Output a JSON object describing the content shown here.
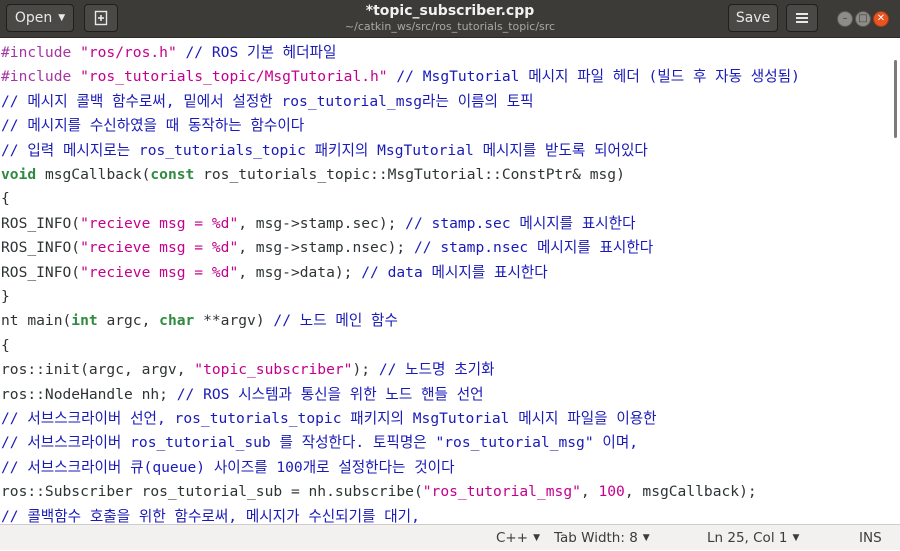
{
  "header": {
    "open_label": "Open",
    "save_label": "Save",
    "title": "*topic_subscriber.cpp",
    "subtitle": "~/catkin_ws/src/ros_tutorials_topic/src"
  },
  "editor": {
    "lines": [
      [
        {
          "t": "pre",
          "v": "#include "
        },
        {
          "t": "str",
          "v": "\"ros/ros.h\""
        },
        {
          "t": "com",
          "v": " // ROS 기본 헤더파일"
        }
      ],
      [
        {
          "t": "pre",
          "v": "#include "
        },
        {
          "t": "str",
          "v": "\"ros_tutorials_topic/MsgTutorial.h\""
        },
        {
          "t": "com",
          "v": " // MsgTutorial 메시지 파일 헤더 (빌드 후 자동 생성됨)"
        }
      ],
      [
        {
          "t": "com",
          "v": "// 메시지 콜백 함수로써, 밑에서 설정한 ros_tutorial_msg라는 이름의 토픽"
        }
      ],
      [
        {
          "t": "com",
          "v": "// 메시지를 수신하였을 때 동작하는 함수이다"
        }
      ],
      [
        {
          "t": "com",
          "v": "// 입력 메시지로는 ros_tutorials_topic 패키지의 MsgTutorial 메시지를 받도록 되어있다"
        }
      ],
      [
        {
          "t": "kw",
          "v": "void"
        },
        {
          "t": "plain",
          "v": " msgCallback("
        },
        {
          "t": "kw",
          "v": "const"
        },
        {
          "t": "plain",
          "v": " ros_tutorials_topic::MsgTutorial::ConstPtr& msg)"
        }
      ],
      [
        {
          "t": "plain",
          "v": "{"
        }
      ],
      [
        {
          "t": "plain",
          "v": "ROS_INFO("
        },
        {
          "t": "str",
          "v": "\"recieve msg = %d\""
        },
        {
          "t": "plain",
          "v": ", msg->stamp.sec); "
        },
        {
          "t": "com",
          "v": "// stamp.sec 메시지를 표시한다"
        }
      ],
      [
        {
          "t": "plain",
          "v": "ROS_INFO("
        },
        {
          "t": "str",
          "v": "\"recieve msg = %d\""
        },
        {
          "t": "plain",
          "v": ", msg->stamp.nsec); "
        },
        {
          "t": "com",
          "v": "// stamp.nsec 메시지를 표시한다"
        }
      ],
      [
        {
          "t": "plain",
          "v": "ROS_INFO("
        },
        {
          "t": "str",
          "v": "\"recieve msg = %d\""
        },
        {
          "t": "plain",
          "v": ", msg->data); "
        },
        {
          "t": "com",
          "v": "// data 메시지를 표시한다"
        }
      ],
      [
        {
          "t": "plain",
          "v": "}"
        }
      ],
      [
        {
          "t": "plain",
          "v": "nt main("
        },
        {
          "t": "kw",
          "v": "int"
        },
        {
          "t": "plain",
          "v": " argc, "
        },
        {
          "t": "kw",
          "v": "char"
        },
        {
          "t": "plain",
          "v": " **argv) "
        },
        {
          "t": "com",
          "v": "// 노드 메인 함수"
        }
      ],
      [
        {
          "t": "plain",
          "v": "{"
        }
      ],
      [
        {
          "t": "plain",
          "v": "ros::init(argc, argv, "
        },
        {
          "t": "str",
          "v": "\"topic_subscriber\""
        },
        {
          "t": "plain",
          "v": "); "
        },
        {
          "t": "com",
          "v": "// 노드명 초기화"
        }
      ],
      [
        {
          "t": "plain",
          "v": "ros::NodeHandle nh; "
        },
        {
          "t": "com",
          "v": "// ROS 시스템과 통신을 위한 노드 핸들 선언"
        }
      ],
      [
        {
          "t": "com",
          "v": "// 서브스크라이버 선언, ros_tutorials_topic 패키지의 MsgTutorial 메시지 파일을 이용한"
        }
      ],
      [
        {
          "t": "com",
          "v": "// 서브스크라이버 ros_tutorial_sub 를 작성한다. 토픽명은 \"ros_tutorial_msg\" 이며,"
        }
      ],
      [
        {
          "t": "com",
          "v": "// 서브스크라이버 큐(queue) 사이즈를 100개로 설정한다는 것이다"
        }
      ],
      [
        {
          "t": "plain",
          "v": "ros::Subscriber ros_tutorial_sub = nh.subscribe("
        },
        {
          "t": "str",
          "v": "\"ros_tutorial_msg\""
        },
        {
          "t": "plain",
          "v": ", "
        },
        {
          "t": "num",
          "v": "100"
        },
        {
          "t": "plain",
          "v": ", msgCallback);"
        }
      ],
      [
        {
          "t": "com",
          "v": "// 콜백함수 호출을 위한 함수로써, 메시지가 수신되기를 대기,"
        }
      ]
    ]
  },
  "statusbar": {
    "language": "C++",
    "tab_width": "Tab Width: 8",
    "position": "Ln 25, Col 1",
    "mode": "INS"
  },
  "icons": {
    "new_tab": "new-document-icon",
    "menu": "hamburger-menu-icon",
    "minimize": "minimize-icon",
    "maximize": "maximize-icon",
    "close": "close-icon"
  },
  "colors": {
    "titlebar": "#3c3b37",
    "close_button": "#e95420",
    "preprocessor": "#a535a0",
    "string": "#c4008c",
    "comment": "#1a1ab8",
    "keyword": "#2e8b3f",
    "text": "#2e3436"
  }
}
